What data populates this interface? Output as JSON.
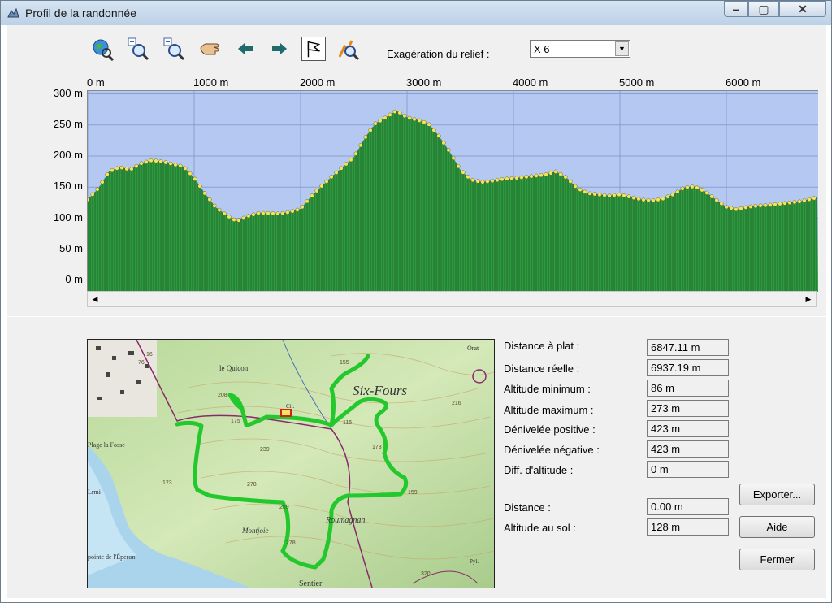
{
  "window": {
    "title": "Profil de la randonnée"
  },
  "titlebar_buttons": {
    "minimize": "▬",
    "maximize": "▢",
    "close": "✕"
  },
  "toolbar": {
    "icons": [
      "globe-zoom-icon",
      "zoom-in-icon",
      "zoom-out-icon",
      "pan-hand-icon",
      "back-arrow-icon",
      "forward-arrow-icon",
      "flag-icon",
      "profile-zoom-icon"
    ],
    "exaggeration_label": "Exagération du relief :",
    "exaggeration_value": "X 6"
  },
  "chart_data": {
    "type": "area",
    "xlabel": "",
    "ylabel": "",
    "x_ticks": [
      "0 m",
      "1000 m",
      "2000 m",
      "3000 m",
      "4000 m",
      "5000 m",
      "6000 m"
    ],
    "y_ticks": [
      "300 m",
      "250 m",
      "200 m",
      "150 m",
      "100 m",
      "50 m",
      "0 m"
    ],
    "xlim": [
      0,
      6847
    ],
    "ylim": [
      0,
      300
    ],
    "grid": true,
    "fill_color": "#2e9a3f",
    "point_color": "#f2e55c",
    "background_color": "#b4c8f2",
    "x": [
      0,
      100,
      200,
      300,
      400,
      500,
      600,
      700,
      800,
      900,
      1000,
      1100,
      1200,
      1300,
      1400,
      1500,
      1600,
      1700,
      1800,
      1900,
      2000,
      2100,
      2200,
      2300,
      2400,
      2500,
      2600,
      2700,
      2800,
      2900,
      3000,
      3100,
      3200,
      3300,
      3400,
      3500,
      3600,
      3700,
      3800,
      3900,
      4000,
      4100,
      4200,
      4300,
      4400,
      4500,
      4600,
      4700,
      4800,
      4900,
      5000,
      5100,
      5200,
      5300,
      5400,
      5500,
      5600,
      5700,
      5800,
      5900,
      6000,
      6100,
      6200,
      6300,
      6400,
      6500,
      6600,
      6700,
      6847
    ],
    "y": [
      130,
      148,
      175,
      182,
      178,
      188,
      193,
      191,
      187,
      183,
      165,
      140,
      118,
      105,
      95,
      103,
      108,
      108,
      107,
      110,
      115,
      135,
      152,
      168,
      183,
      198,
      228,
      252,
      262,
      273,
      262,
      258,
      252,
      232,
      207,
      178,
      162,
      158,
      160,
      163,
      164,
      166,
      168,
      170,
      175,
      165,
      148,
      140,
      138,
      136,
      138,
      134,
      130,
      128,
      131,
      138,
      149,
      151,
      143,
      130,
      118,
      114,
      118,
      120,
      121,
      123,
      125,
      127,
      133
    ]
  },
  "stats": {
    "distance_plat": {
      "label": "Distance à plat :",
      "value": "6847.11 m"
    },
    "distance_reelle": {
      "label": "Distance réelle :",
      "value": "6937.19 m"
    },
    "altitude_min": {
      "label": "Altitude minimum :",
      "value": "86 m"
    },
    "altitude_max": {
      "label": "Altitude maximum :",
      "value": "273 m"
    },
    "denivelee_pos": {
      "label": "Dénivelée positive :",
      "value": "423 m"
    },
    "denivelee_neg": {
      "label": "Dénivelée négative :",
      "value": "423 m"
    },
    "diff_altitude": {
      "label": "Diff. d'altitude :",
      "value": "0 m"
    },
    "distance": {
      "label": "Distance :",
      "value": "0.00 m"
    },
    "altitude_sol": {
      "label": "Altitude au sol :",
      "value": "128 m"
    }
  },
  "buttons": {
    "exporter": "Exporter...",
    "aide": "Aide",
    "fermer": "Fermer"
  },
  "map_labels": [
    "le Quicon",
    "Six-Fours",
    "Plage la Fosse",
    "Montjoie",
    "Roumagnan",
    "pointe de l'Éperon",
    "Orat",
    "Sentier",
    "Lrmi",
    "Pyl.",
    "Cit."
  ],
  "map_heights": [
    "155",
    "208",
    "175",
    "115",
    "239",
    "123",
    "259",
    "278",
    "278",
    "159",
    "173",
    "216",
    "320",
    "16",
    "76"
  ]
}
